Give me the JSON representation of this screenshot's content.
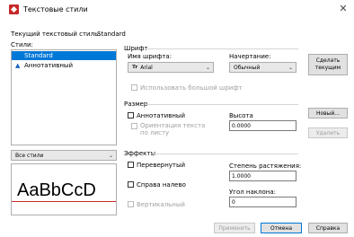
{
  "window": {
    "title": "Текстовые стили",
    "close_glyph": "✕"
  },
  "current_style": {
    "label": "Текущий текстовый стиль:",
    "value": "Standard"
  },
  "styles_list": {
    "label": "Стили:",
    "items": [
      {
        "label": "Standard"
      },
      {
        "label": "Аннотативный"
      }
    ]
  },
  "filter_select": {
    "value": "Все стили"
  },
  "preview": {
    "text": "AaBbCcD"
  },
  "font_group": {
    "title": "Шрифт",
    "font_name_label": "Имя шрифта:",
    "font_name_value": "Arial",
    "style_label": "Начертание:",
    "style_value": "Обычный",
    "big_font_label": "Использовать большой шрифт"
  },
  "size_group": {
    "title": "Размер",
    "annotative_label": "Аннотативный",
    "orientation_label_1": "Ориентация текста",
    "orientation_label_2": "по листу",
    "height_label": "Высота",
    "height_value": "0.0000"
  },
  "effects_group": {
    "title": "Эффекты",
    "upside_down_label": "Перевернутый",
    "backwards_label": "Справа налево",
    "vertical_label": "Вертикальный",
    "width_factor_label": "Степень растяжения:",
    "width_factor_value": "1.0000",
    "oblique_label": "Угол наклона:",
    "oblique_value": "0"
  },
  "side_buttons": {
    "set_current_1": "Сделать",
    "set_current_2": "текущим",
    "new": "Новый...",
    "delete": "Удалить"
  },
  "bottom_buttons": {
    "apply": "Применить",
    "cancel": "Отмена",
    "help": "Справка"
  },
  "colors": {
    "selection": "#0078d7",
    "preview_line": "#c62828"
  }
}
